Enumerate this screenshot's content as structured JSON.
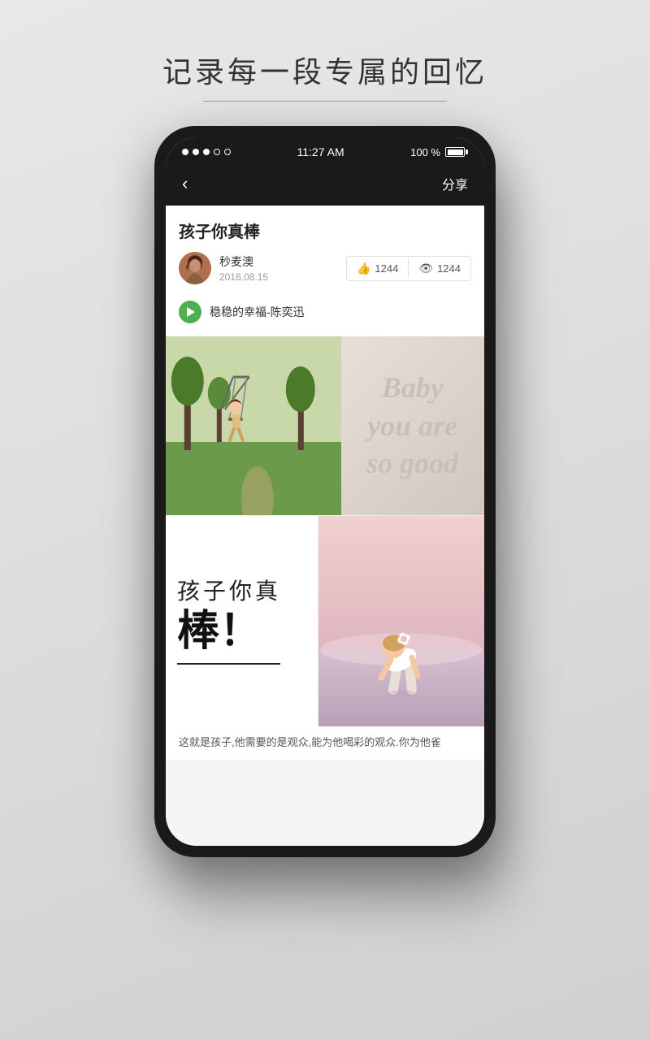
{
  "page": {
    "tagline": "记录每一段专属的回忆"
  },
  "status_bar": {
    "signal_dots": [
      "filled",
      "filled",
      "filled",
      "empty",
      "empty"
    ],
    "time": "11:27 AM",
    "battery_pct": "100 %"
  },
  "nav": {
    "back_label": "‹",
    "share_label": "分享"
  },
  "post": {
    "title": "孩子你真棒",
    "author_name": "秒麦澳",
    "post_date": "2016.08.15",
    "like_count": "1244",
    "view_count": "1244",
    "music_title": "稳稳的幸福-陈奕迅"
  },
  "image_panel": {
    "baby_text_line1": "Baby",
    "baby_text_line2": "you are",
    "baby_text_line3": "so good"
  },
  "text_panel": {
    "title_line": "孩子你真",
    "big_word": "棒！"
  },
  "description": {
    "text": "这就是孩子,他需要的是观众,能为他喝彩的观众.你为他雀"
  }
}
